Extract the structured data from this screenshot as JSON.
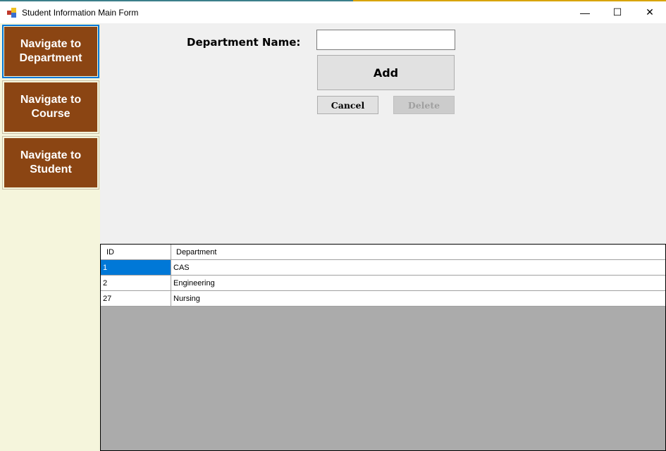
{
  "window": {
    "title": "Student Information Main Form",
    "minimize": "—",
    "maximize": "☐",
    "close": "✕"
  },
  "sidebar": {
    "items": [
      {
        "label": "Navigate to Department"
      },
      {
        "label": "Navigate to Course"
      },
      {
        "label": "Navigate to Student"
      }
    ]
  },
  "form": {
    "department_label": "Department Name:",
    "department_value": "",
    "add_label": "Add",
    "cancel_label": "Cancel",
    "delete_label": "Delete"
  },
  "grid": {
    "columns": [
      "ID",
      "Department"
    ],
    "rows": [
      [
        "1",
        "CAS"
      ],
      [
        "2",
        "Engineering"
      ],
      [
        "27",
        "Nursing"
      ]
    ]
  },
  "colors": {
    "nav": "#8b4513",
    "sidebar": "#f5f5dc",
    "selection": "#0078d7"
  }
}
